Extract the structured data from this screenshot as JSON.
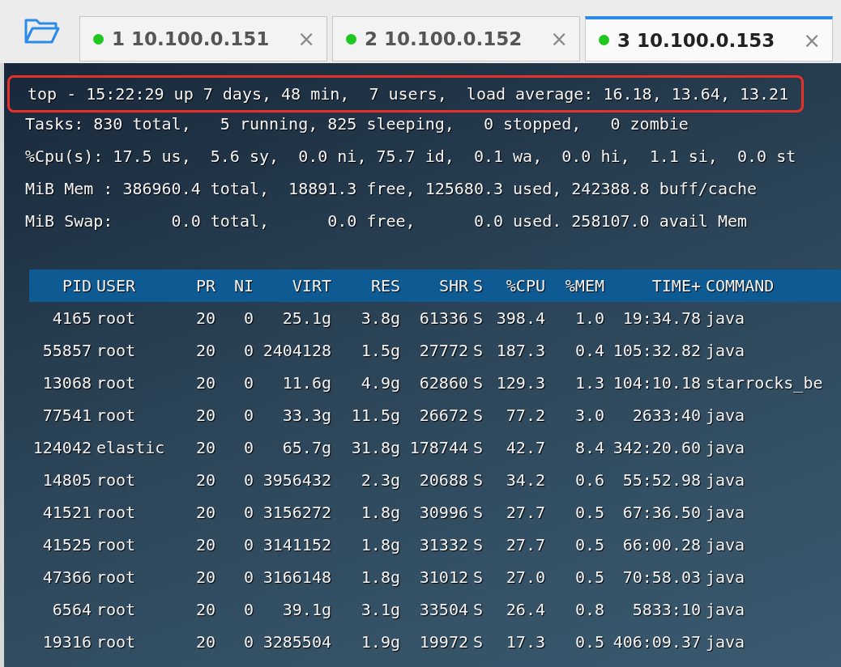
{
  "tabs": [
    {
      "number": "1",
      "label": "10.100.0.151",
      "connected": true,
      "selected": false,
      "close": "×"
    },
    {
      "number": "2",
      "label": "10.100.0.152",
      "connected": true,
      "selected": false,
      "close": "×"
    },
    {
      "number": "3",
      "label": "10.100.0.153",
      "connected": true,
      "selected": true,
      "close": "×"
    }
  ],
  "summary": [
    {
      "text": "top - 15:22:29 up 7 days, 48 min,  7 users,  load average: 16.18, 13.64, 13.21",
      "highlighted": true
    },
    {
      "text": "Tasks: 830 total,   5 running, 825 sleeping,   0 stopped,   0 zombie",
      "highlighted": false
    },
    {
      "text": "%Cpu(s): 17.5 us,  5.6 sy,  0.0 ni, 75.7 id,  0.1 wa,  0.0 hi,  1.1 si,  0.0 st",
      "highlighted": false
    },
    {
      "text": "MiB Mem : 386960.4 total,  18891.3 free, 125680.3 used, 242388.8 buff/cache",
      "highlighted": false
    },
    {
      "text": "MiB Swap:      0.0 total,      0.0 free,      0.0 used. 258107.0 avail Mem",
      "highlighted": false
    }
  ],
  "table": {
    "columns": [
      "PID",
      "USER",
      "PR",
      "NI",
      "VIRT",
      "RES",
      "SHR",
      "S",
      "%CPU",
      "%MEM",
      "TIME+",
      "COMMAND"
    ],
    "rows": [
      [
        "4165",
        "root",
        "20",
        "0",
        "25.1g",
        "3.8g",
        "61336",
        "S",
        "398.4",
        "1.0",
        "19:34.78",
        "java"
      ],
      [
        "55857",
        "root",
        "20",
        "0",
        "2404128",
        "1.5g",
        "27772",
        "S",
        "187.3",
        "0.4",
        "105:32.82",
        "java"
      ],
      [
        "13068",
        "root",
        "20",
        "0",
        "11.6g",
        "4.9g",
        "62860",
        "S",
        "129.3",
        "1.3",
        "104:10.18",
        "starrocks_be"
      ],
      [
        "77541",
        "root",
        "20",
        "0",
        "33.3g",
        "11.5g",
        "26672",
        "S",
        "77.2",
        "3.0",
        "2633:40",
        "java"
      ],
      [
        "124042",
        "elastic",
        "20",
        "0",
        "65.7g",
        "31.8g",
        "178744",
        "S",
        "42.7",
        "8.4",
        "342:20.60",
        "java"
      ],
      [
        "14805",
        "root",
        "20",
        "0",
        "3956432",
        "2.3g",
        "20688",
        "S",
        "34.2",
        "0.6",
        "55:52.98",
        "java"
      ],
      [
        "41521",
        "root",
        "20",
        "0",
        "3156272",
        "1.8g",
        "30996",
        "S",
        "27.7",
        "0.5",
        "67:36.50",
        "java"
      ],
      [
        "41525",
        "root",
        "20",
        "0",
        "3141152",
        "1.8g",
        "31332",
        "S",
        "27.7",
        "0.5",
        "66:00.28",
        "java"
      ],
      [
        "47366",
        "root",
        "20",
        "0",
        "3166148",
        "1.8g",
        "31012",
        "S",
        "27.0",
        "0.5",
        "70:58.03",
        "java"
      ],
      [
        "6564",
        "root",
        "20",
        "0",
        "39.1g",
        "3.1g",
        "33504",
        "S",
        "26.4",
        "0.8",
        "5833:10",
        "java"
      ],
      [
        "19316",
        "root",
        "20",
        "0",
        "3285504",
        "1.9g",
        "19972",
        "S",
        "17.3",
        "0.5",
        "406:09.37",
        "java"
      ]
    ]
  }
}
